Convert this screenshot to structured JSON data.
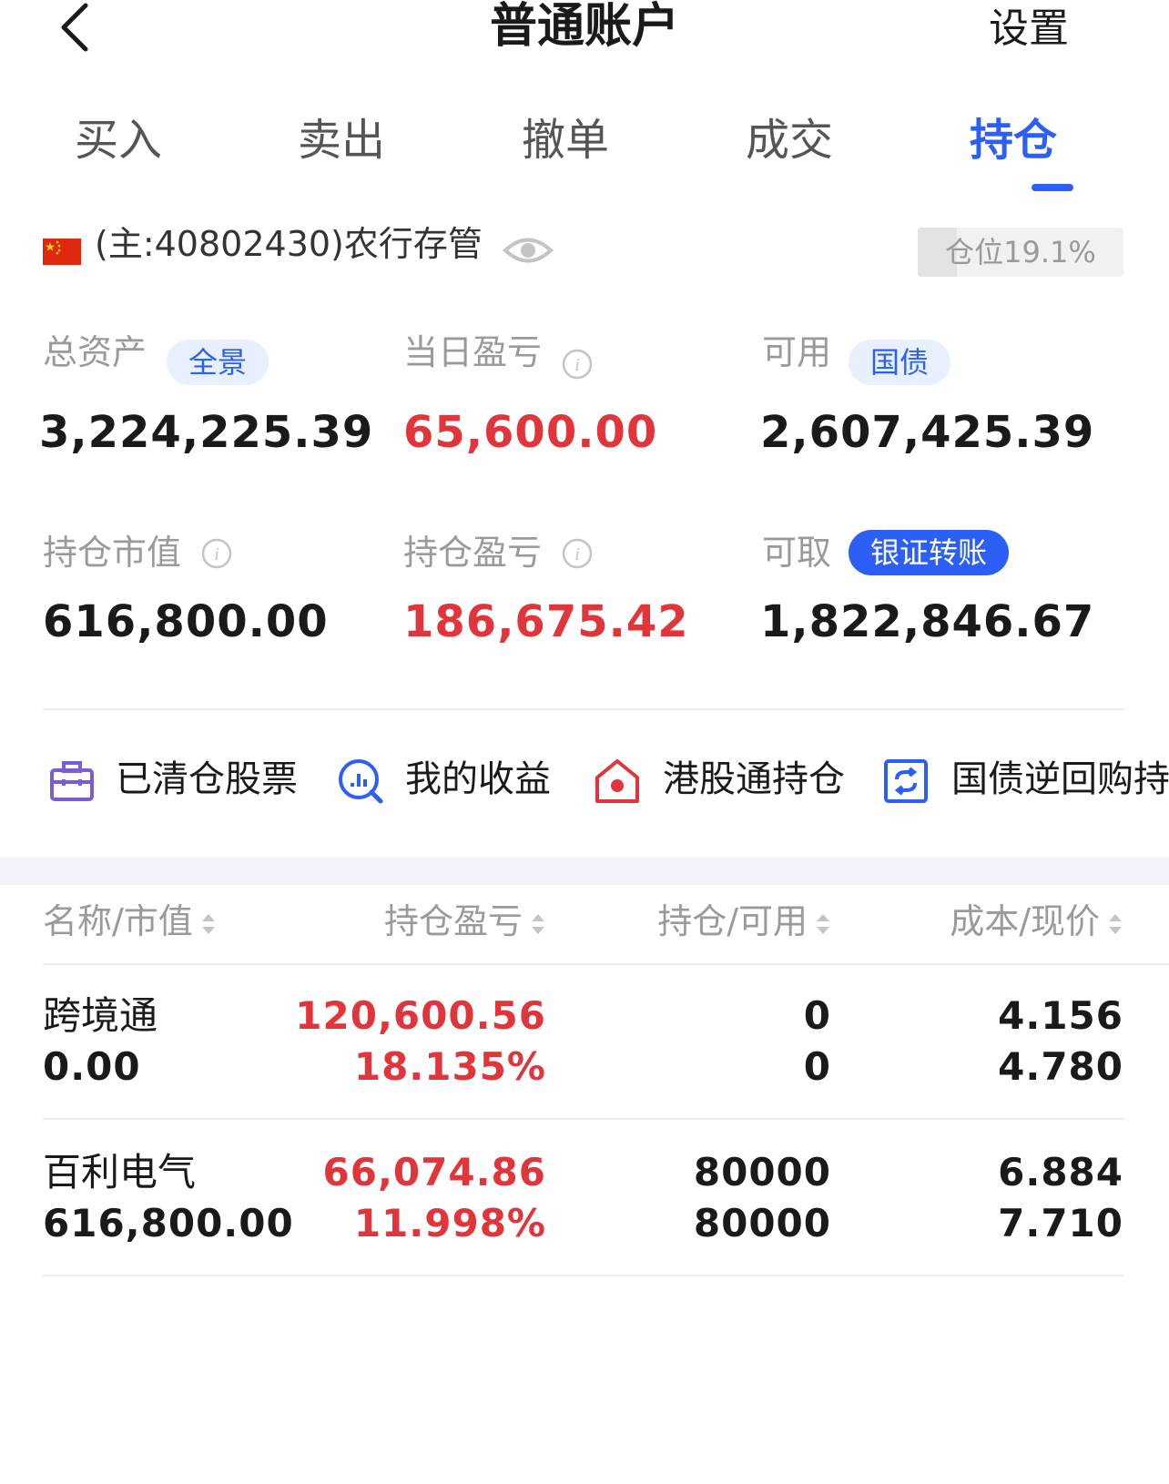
{
  "header": {
    "title": "普通账户",
    "settings_label": "设置"
  },
  "tabs": [
    {
      "label": "买入",
      "active": false
    },
    {
      "label": "卖出",
      "active": false
    },
    {
      "label": "撤单",
      "active": false
    },
    {
      "label": "成交",
      "active": false
    },
    {
      "label": "持仓",
      "active": true
    }
  ],
  "account": {
    "label": "(主:40802430)农行存管",
    "position_label": "仓位19.1%",
    "position_ratio": 0.191
  },
  "metrics": {
    "total_assets": {
      "label": "总资产",
      "tag": "全景",
      "value": "3,224,225.39"
    },
    "daily_pnl": {
      "label": "当日盈亏",
      "value": "65,600.00"
    },
    "available": {
      "label": "可用",
      "tag": "国债",
      "value": "2,607,425.39"
    },
    "market_value": {
      "label": "持仓市值",
      "value": "616,800.00"
    },
    "holding_pnl": {
      "label": "持仓盈亏",
      "value": "186,675.42"
    },
    "withdrawable": {
      "label": "可取",
      "tag": "银证转账",
      "value": "1,822,846.67"
    }
  },
  "shortcuts": [
    {
      "label": "已清仓股票",
      "icon": "briefcase-icon"
    },
    {
      "label": "我的收益",
      "icon": "chart-search-icon"
    },
    {
      "label": "港股通持仓",
      "icon": "hk-house-icon"
    },
    {
      "label": "国债逆回购持仓",
      "icon": "exchange-icon"
    }
  ],
  "table": {
    "headers": [
      "名称/市值",
      "持仓盈亏",
      "持仓/可用",
      "成本/现价"
    ],
    "rows": [
      {
        "name": "跨境通",
        "market_value": "0.00",
        "pnl": "120,600.56",
        "pnl_pct": "18.135%",
        "holding": "0",
        "available": "0",
        "cost": "4.156",
        "price": "4.780"
      },
      {
        "name": "百利电气",
        "market_value": "616,800.00",
        "pnl": "66,074.86",
        "pnl_pct": "11.998%",
        "holding": "80000",
        "available": "80000",
        "cost": "6.884",
        "price": "7.710"
      }
    ]
  },
  "colors": {
    "accent": "#2c5ff6",
    "loss_gain_red": "#e0353b",
    "muted": "#9a9a9a"
  }
}
